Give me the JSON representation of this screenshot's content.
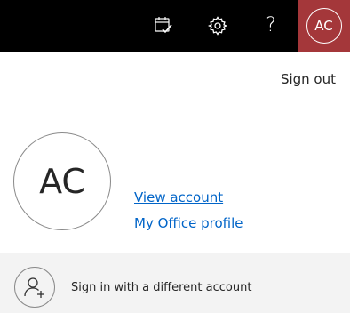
{
  "header": {
    "background": "#000000",
    "icons": [
      "calendar-check-icon",
      "gear-icon",
      "help-icon"
    ],
    "help_label": "?",
    "account_initials": "AC",
    "account_tile_color": "#a4373a"
  },
  "account_panel": {
    "sign_out_label": "Sign out",
    "avatar_initials": "AC",
    "view_account_label": "View account",
    "office_profile_label": "My Office profile",
    "link_color": "#0064c8"
  },
  "footer": {
    "label": "Sign in with a different account",
    "icon": "add-person-icon"
  }
}
